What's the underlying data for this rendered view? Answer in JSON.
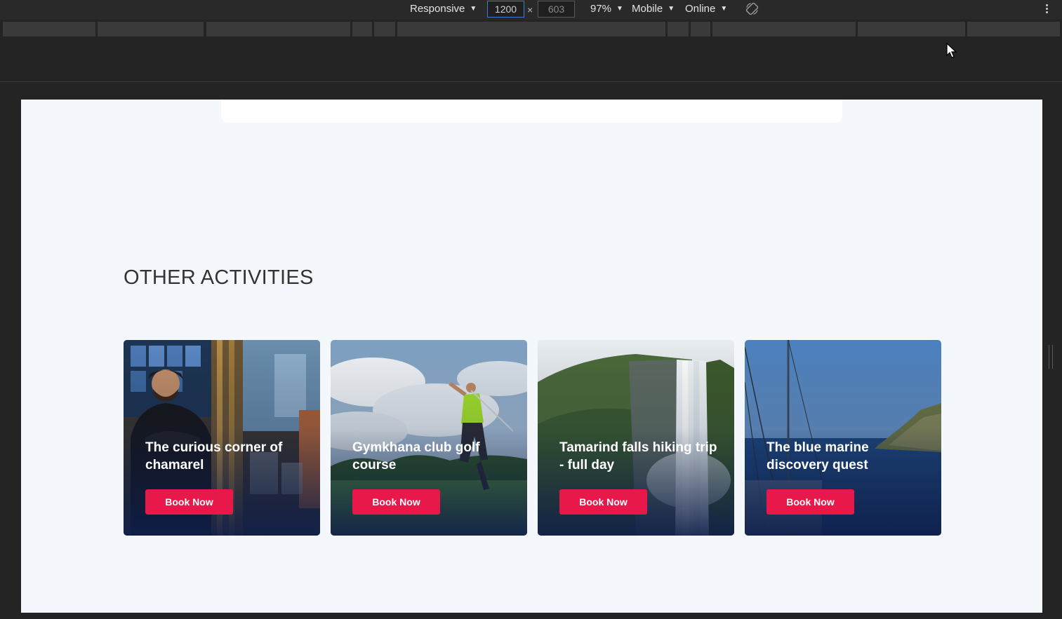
{
  "devtools": {
    "device_mode": "Responsive",
    "width": "1200",
    "height": "603",
    "dimension_separator": "×",
    "zoom": "97%",
    "throttle_profile": "Mobile",
    "network": "Online",
    "rotate_icon": "rotate-icon",
    "more_icon": "kebab-icon"
  },
  "page": {
    "section_title": "OTHER ACTIVITIES",
    "activities": [
      {
        "title": "The curious corner of chamarel",
        "button": "Book Now",
        "image": "bar-server-photo"
      },
      {
        "title": "Gymkhana club golf course",
        "button": "Book Now",
        "image": "golfer-photo"
      },
      {
        "title": "Tamarind falls hiking trip - full day",
        "button": "Book Now",
        "image": "waterfall-photo"
      },
      {
        "title": "The blue marine discovery quest",
        "button": "Book Now",
        "image": "sea-sailboat-photo"
      }
    ]
  },
  "colors": {
    "accent": "#e8194a",
    "page_background": "#f4f8fc",
    "devtools_background": "#242424"
  }
}
